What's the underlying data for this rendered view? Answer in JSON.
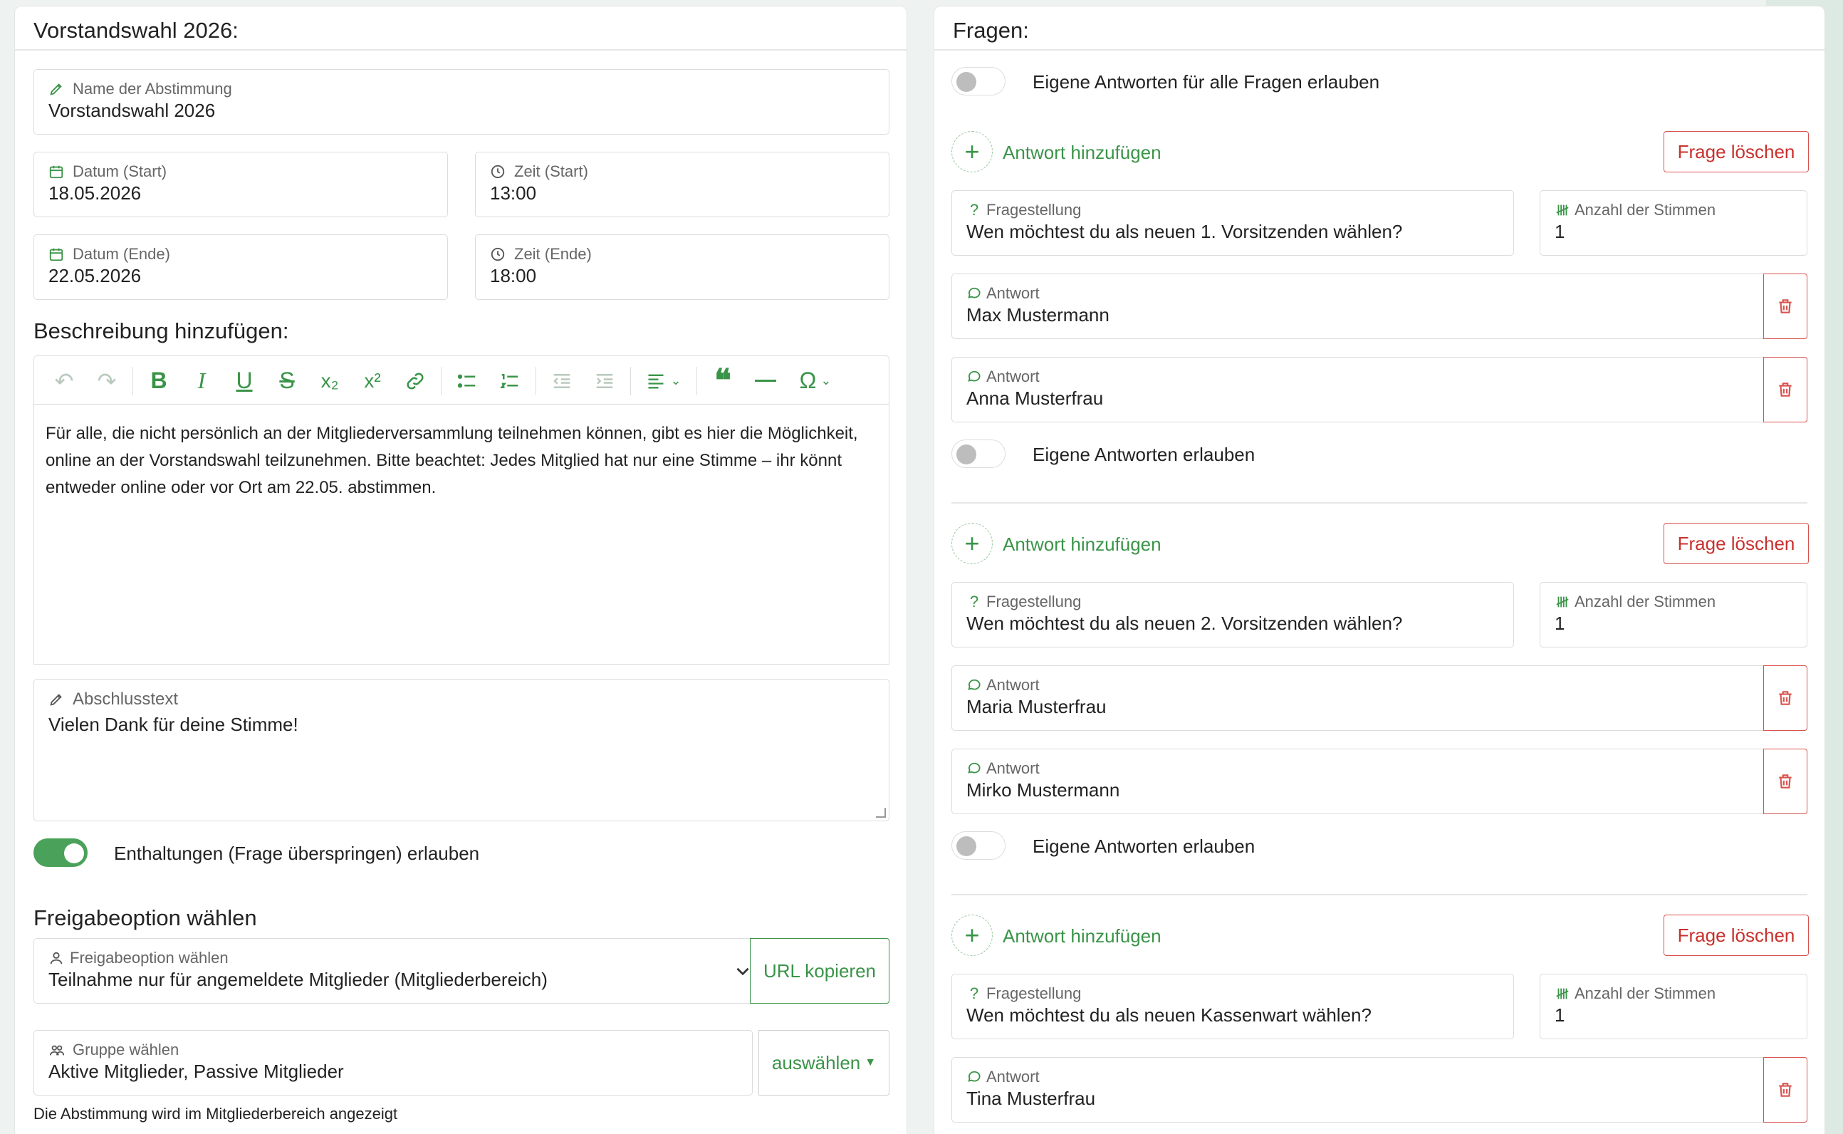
{
  "left": {
    "title": "Vorstandswahl 2026:",
    "name_field": {
      "label": "Name der Abstimmung",
      "value": "Vorstandswahl 2026"
    },
    "start_date": {
      "label": "Datum (Start)",
      "value": "18.05.2026"
    },
    "start_time": {
      "label": "Zeit (Start)",
      "value": "13:00"
    },
    "end_date": {
      "label": "Datum (Ende)",
      "value": "22.05.2026"
    },
    "end_time": {
      "label": "Zeit (Ende)",
      "value": "18:00"
    },
    "description_heading": "Beschreibung hinzufügen:",
    "description_text": "Für alle, die nicht persönlich an der Mitgliederversammlung teilnehmen können, gibt es hier die Möglichkeit, online an der Vorstandswahl teilzunehmen. Bitte beachtet: Jedes Mitglied hat nur eine Stimme – ihr könnt entweder online oder vor Ort am 22.05. abstimmen.",
    "closing": {
      "label": "Abschlusstext",
      "value": "Vielen Dank für deine Stimme!"
    },
    "abstain_toggle": {
      "label": "Enthaltungen (Frage überspringen) erlauben",
      "on": true
    },
    "release_heading": "Freigabeoption wählen",
    "release_select": {
      "label": "Freigabeoption wählen",
      "value": "Teilnahme nur für angemeldete Mitglieder (Mitgliederbereich)"
    },
    "copy_url_label": "URL kopieren",
    "group_select": {
      "label": "Gruppe wählen",
      "value": "Aktive Mitglieder, Passive Mitglieder",
      "button": "auswählen"
    },
    "hint": "Die Abstimmung wird im Mitgliederbereich angezeigt"
  },
  "right": {
    "title": "Fragen:",
    "allow_all_label": "Eigene Antworten für alle Fragen erlauben",
    "add_answer_label": "Antwort hinzufügen",
    "delete_question_label": "Frage löschen",
    "question_label": "Fragestellung",
    "votes_label": "Anzahl der Stimmen",
    "answer_label": "Antwort",
    "allow_own_label": "Eigene Antworten erlauben",
    "questions": [
      {
        "text": "Wen möchtest du als neuen 1. Vorsitzenden wählen?",
        "votes": "1",
        "answers": [
          "Max Mustermann",
          "Anna Musterfrau"
        ]
      },
      {
        "text": "Wen möchtest du als neuen 2. Vorsitzenden wählen?",
        "votes": "1",
        "answers": [
          "Maria Musterfrau",
          "Mirko Mustermann"
        ]
      },
      {
        "text": "Wen möchtest du als neuen Kassenwart wählen?",
        "votes": "1",
        "answers": [
          "Tina Musterfrau"
        ]
      }
    ]
  },
  "colors": {
    "accent": "#3a9448",
    "danger": "#d9534f"
  }
}
